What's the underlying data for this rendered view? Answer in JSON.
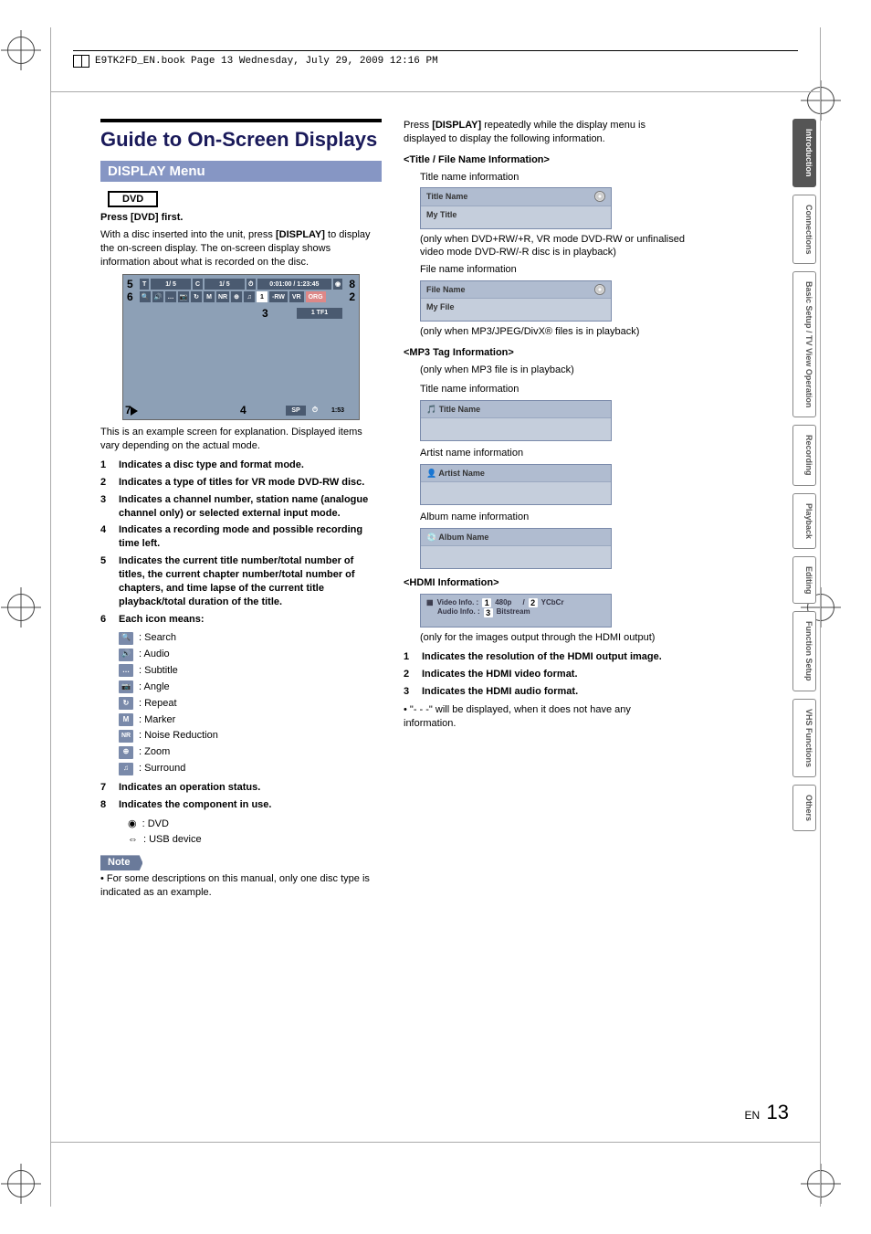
{
  "header": {
    "filename": "E9TK2FD_EN.book",
    "page_info": "Page 13  Wednesday, July 29, 2009  12:16 PM"
  },
  "title": "Guide to On-Screen Displays",
  "subsection": "DISPLAY Menu",
  "dvd_tag": "DVD",
  "intro": {
    "line1": "Press [DVD] first.",
    "line2_a": "With a disc inserted into the unit, press ",
    "line2_b": "[DISPLAY]",
    "line2_c": " to display the on-screen display. The on-screen display shows information about what is recorded on the disc."
  },
  "osd": {
    "row1": {
      "t": "T",
      "tv": "1/  5",
      "c": "C",
      "cv": "1/  5",
      "clock": "0:01:00 / 1:23:45"
    },
    "row2": {
      "one": "1",
      "rw": "-RW",
      "vr": "VR",
      "org": "ORG",
      "nr": "NR"
    },
    "row3": {
      "ch": "1  TF1"
    },
    "bottom": {
      "sp": "SP",
      "time": "1:53"
    },
    "callouts": {
      "c1": "1",
      "c2": "2",
      "c3": "3",
      "c4": "4",
      "c5": "5",
      "c6": "6",
      "c7": "7",
      "c8": "8"
    }
  },
  "example_note": "This is an example screen for explanation. Displayed items vary depending on the actual mode.",
  "numbered": [
    {
      "n": "1",
      "t": "Indicates a disc type and format mode."
    },
    {
      "n": "2",
      "t": "Indicates a type of titles for VR mode DVD-RW disc."
    },
    {
      "n": "3",
      "t": "Indicates a channel number, station name (analogue channel only) or selected external input mode."
    },
    {
      "n": "4",
      "t": "Indicates a recording mode and possible recording time left."
    },
    {
      "n": "5",
      "t": "Indicates the current title number/total number of titles, the current chapter number/total number of chapters, and time lapse of the current title playback/total duration of the title."
    },
    {
      "n": "6",
      "t": "Each icon means:"
    }
  ],
  "icons": [
    {
      "sym": "🔍",
      "label": ": Search"
    },
    {
      "sym": "🔊",
      "label": ": Audio"
    },
    {
      "sym": "…",
      "label": ": Subtitle"
    },
    {
      "sym": "📷",
      "label": ": Angle"
    },
    {
      "sym": "↻",
      "label": ": Repeat"
    },
    {
      "sym": "M",
      "label": ": Marker"
    },
    {
      "sym": "NR",
      "label": ": Noise Reduction"
    },
    {
      "sym": "⊕",
      "label": ": Zoom"
    },
    {
      "sym": "♫",
      "label": ": Surround"
    }
  ],
  "numbered2": [
    {
      "n": "7",
      "t": "Indicates an operation status."
    },
    {
      "n": "8",
      "t": "Indicates the component in use."
    }
  ],
  "component_list": [
    {
      "sym": "◉",
      "label": ": DVD"
    },
    {
      "sym": "⇔",
      "label": ": USB device"
    }
  ],
  "note": {
    "tag": "Note",
    "text": "For some descriptions on this manual, only one disc type is indicated as an example."
  },
  "rightcol": {
    "intro_a": "Press ",
    "intro_b": "[DISPLAY]",
    "intro_c": " repeatedly while the display menu is displayed to display the following information.",
    "sec1_head": "<Title / File Name Information>",
    "sec1_sub1": "Title name information",
    "box_title_head": "Title Name",
    "box_title_body": "My Title",
    "sec1_note1": "(only when DVD+RW/+R, VR mode DVD-RW or unfinalised video mode DVD-RW/-R disc is in playback)",
    "sec1_sub2": "File name information",
    "box_file_head": "File Name",
    "box_file_body": "My File",
    "sec1_note2": "(only when MP3/JPEG/DivX® files is in playback)",
    "sec2_head": "<MP3 Tag Information>",
    "sec2_sub0": "(only when MP3 file is in playback)",
    "sec2_sub1": "Title name information",
    "box_mp3_title": "Title Name",
    "sec2_sub2": "Artist name information",
    "box_mp3_artist": "Artist Name",
    "sec2_sub3": "Album name information",
    "box_mp3_album": "Album Name",
    "sec3_head": "<HDMI Information>",
    "hdmi": {
      "video_label": "Video Info.  :",
      "video_val": "480p",
      "video_fmt": "YCbCr",
      "audio_label": "Audio Info.  :",
      "audio_val": "Bitstream",
      "n1": "1",
      "n2": "2",
      "n3": "3",
      "slash": "/"
    },
    "sec3_note": "(only for the images output through the HDMI output)",
    "hdmi_list": [
      {
        "n": "1",
        "t": "Indicates the resolution of the HDMI output image."
      },
      {
        "n": "2",
        "t": "Indicates the HDMI video format."
      },
      {
        "n": "3",
        "t": "Indicates the HDMI audio format."
      }
    ],
    "hdmi_bullet": "\"- - -\" will be displayed, when it does not have any information."
  },
  "tabs": [
    "Introduction",
    "Connections",
    "Basic Setup / TV View Operation",
    "Recording",
    "Playback",
    "Editing",
    "Function Setup",
    "VHS Functions",
    "Others"
  ],
  "footer": {
    "lang": "EN",
    "page": "13"
  }
}
